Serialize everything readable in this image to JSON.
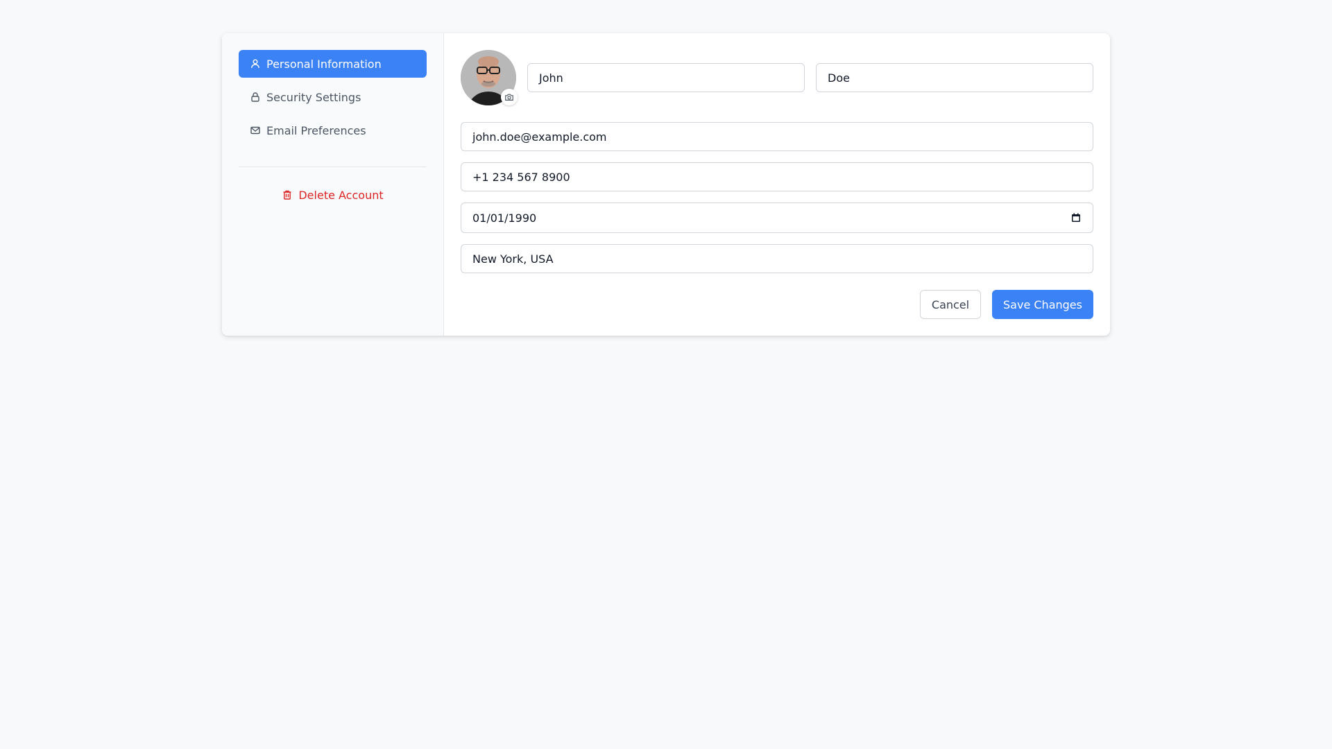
{
  "sidebar": {
    "items": [
      {
        "label": "Personal Information",
        "icon": "user-icon",
        "active": true
      },
      {
        "label": "Security Settings",
        "icon": "lock-icon",
        "active": false
      },
      {
        "label": "Email Preferences",
        "icon": "mail-icon",
        "active": false
      }
    ],
    "delete_label": "Delete Account"
  },
  "profile": {
    "first_name": "John",
    "last_name": "Doe",
    "email": "john.doe@example.com",
    "phone": "+1 234 567 8900",
    "birth_date": "01/01/1990",
    "location": "New York, USA"
  },
  "actions": {
    "cancel_label": "Cancel",
    "save_label": "Save Changes"
  },
  "colors": {
    "accent": "#3b82f6",
    "danger": "#dc2626",
    "page_bg": "#f8f9fb"
  }
}
